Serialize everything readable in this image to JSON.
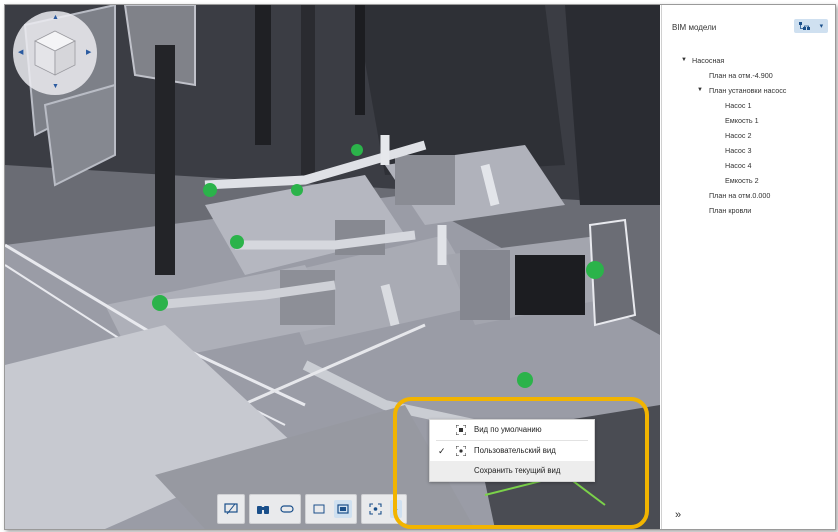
{
  "panel": {
    "title": "BIM модели",
    "tree": [
      {
        "label": "Насосная",
        "level": 0,
        "expanded": true
      },
      {
        "label": "План на отм.-4.900",
        "level": 1
      },
      {
        "label": "План установки насосс",
        "level": 1,
        "expanded": true
      },
      {
        "label": "Насос 1",
        "level": 2
      },
      {
        "label": "Емкость 1",
        "level": 2
      },
      {
        "label": "Насос 2",
        "level": 2
      },
      {
        "label": "Насос 3",
        "level": 2
      },
      {
        "label": "Насос 4",
        "level": 2
      },
      {
        "label": "Емкость 2",
        "level": 2
      },
      {
        "label": "План на отм.0.000",
        "level": 1
      },
      {
        "label": "План кровли",
        "level": 1
      }
    ],
    "collapse_symbol": "»"
  },
  "view_menu": {
    "items": [
      {
        "label": "Вид по умолчанию",
        "icon": "frame-view-icon",
        "checked": false
      },
      {
        "label": "Пользовательский вид",
        "icon": "custom-view-icon",
        "checked": true
      },
      {
        "label": "Сохранить текущий вид",
        "icon": "",
        "checked": false
      }
    ],
    "check_symbol": "✓"
  },
  "colors": {
    "accent": "#1a4f8a",
    "highlight": "#f2b400",
    "valve_green": "#2bb34a"
  }
}
